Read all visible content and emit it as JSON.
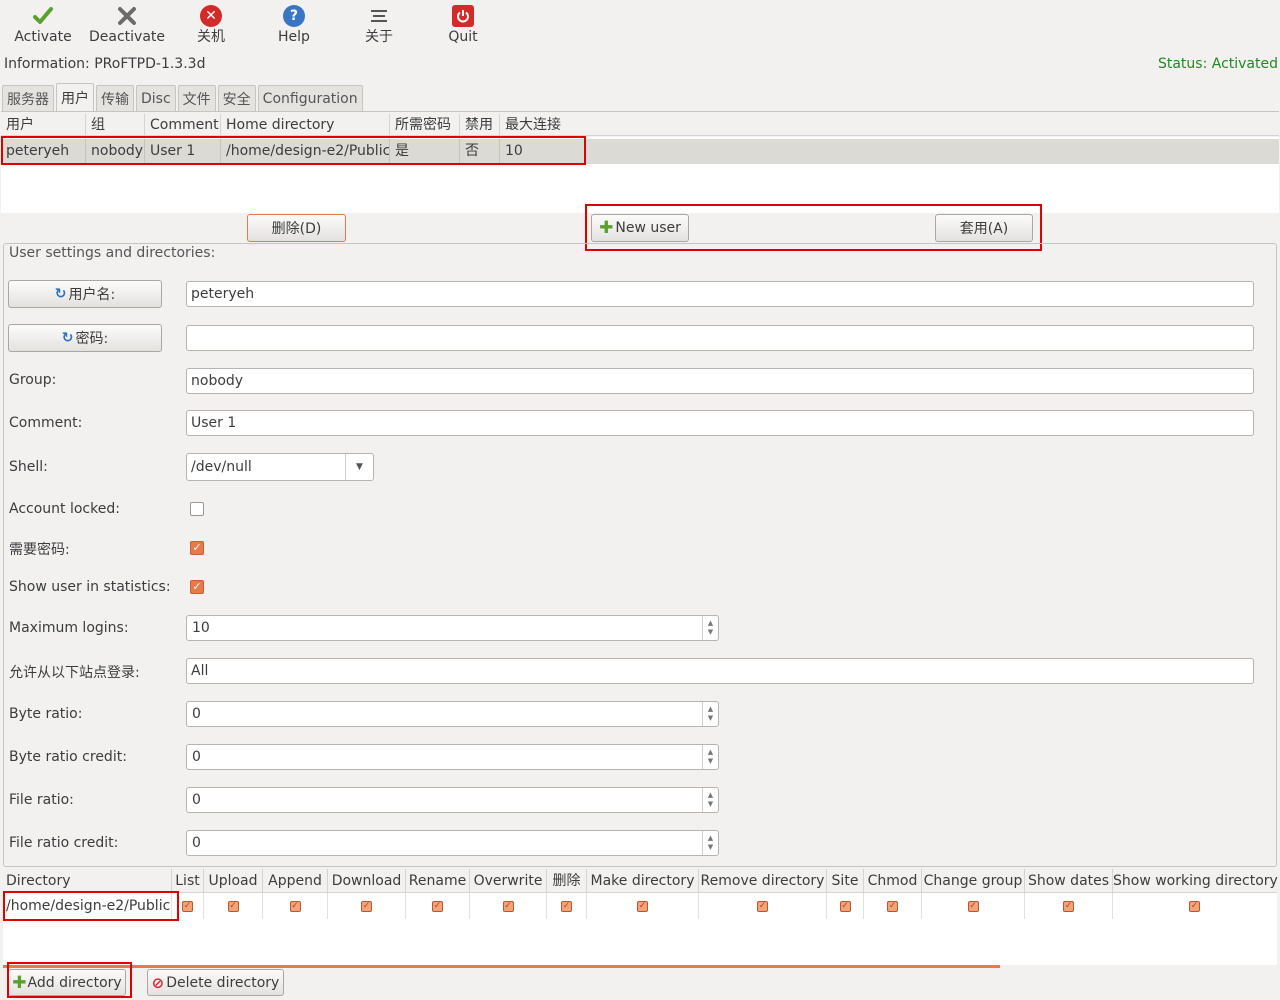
{
  "toolbar": {
    "activate": "Activate",
    "deactivate": "Deactivate",
    "shutdown": "关机",
    "help": "Help",
    "about": "关于",
    "quit": "Quit"
  },
  "info": "Information: PRoFTPD-1.3.3d",
  "status": "Status: Activated",
  "status_color": "#1f8a1f",
  "tabs": [
    "服务器",
    "用户",
    "传输",
    "Disc",
    "文件",
    "安全",
    "Configuration"
  ],
  "active_tab": "用户",
  "user_table": {
    "columns": [
      "用户",
      "组",
      "Comment",
      "Home directory",
      "所需密码",
      "禁用",
      "最大连接"
    ],
    "rows": [
      [
        "peteryeh",
        "nobody",
        "User 1",
        "/home/design-e2/Public",
        "是",
        "否",
        "10"
      ]
    ]
  },
  "buttons": {
    "delete": "删除(D)",
    "new_user": "New user",
    "apply": "套用(A)",
    "add_directory": "Add directory",
    "delete_directory": "Delete directory"
  },
  "settings": {
    "frame_label": "User settings and directories:",
    "username_btn": "用户名:",
    "password_btn": "密码:",
    "username": "peteryeh",
    "password": "",
    "group_label": "Group:",
    "group": "nobody",
    "comment_label": "Comment:",
    "comment": "User 1",
    "shell_label": "Shell:",
    "shell": "/dev/null",
    "locked_label": "Account locked:",
    "locked": false,
    "require_pw_label": "需要密码:",
    "require_pw": true,
    "show_stats_label": "Show user in statistics:",
    "show_stats": true,
    "max_logins_label": "Maximum logins:",
    "max_logins": "10",
    "allow_from_label": "允许从以下站点登录:",
    "allow_from": "All",
    "byte_ratio_label": "Byte ratio:",
    "byte_ratio": "0",
    "byte_credit_label": "Byte ratio credit:",
    "byte_credit": "0",
    "file_ratio_label": "File ratio:",
    "file_ratio": "0",
    "file_credit_label": "File ratio credit:",
    "file_credit": "0"
  },
  "dir_table": {
    "columns": [
      "Directory",
      "List",
      "Upload",
      "Append",
      "Download",
      "Rename",
      "Overwrite",
      "删除",
      "Make directory",
      "Remove directory",
      "Site",
      "Chmod",
      "Change group",
      "Show dates",
      "Show working directory"
    ],
    "rows": [
      {
        "directory": "/home/design-e2/Public",
        "checks": [
          true,
          true,
          true,
          true,
          true,
          true,
          true,
          true,
          true,
          true,
          true,
          true,
          true,
          true
        ]
      }
    ]
  },
  "colors": {
    "accent": "#e87a49",
    "highlight_box": "#e00000",
    "selected_row": "#dcdad5"
  },
  "icons": [
    "checkmark-icon",
    "x-mark-icon",
    "close-circle-icon",
    "help-icon",
    "about-icon",
    "power-icon",
    "plus-icon",
    "refresh-icon",
    "no-entry-icon"
  ]
}
